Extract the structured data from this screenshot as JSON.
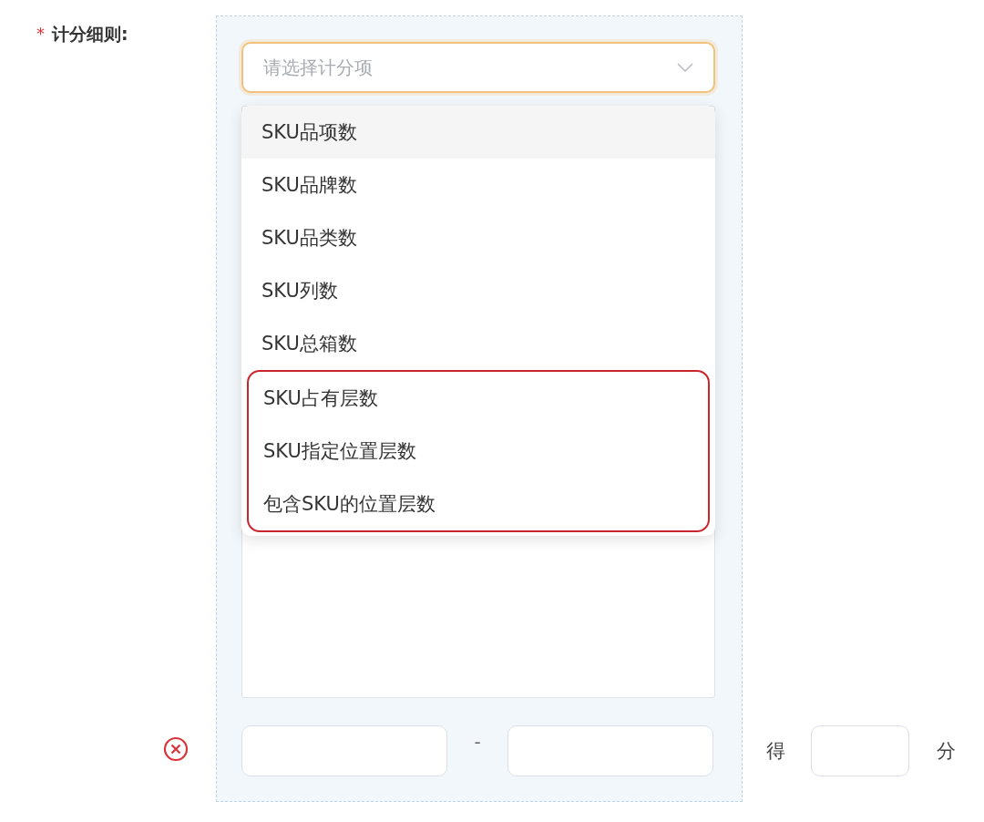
{
  "field": {
    "label": "计分细则:",
    "required_mark": "*"
  },
  "select": {
    "placeholder": "请选择计分项",
    "open": true
  },
  "options": [
    {
      "label": "SKU品项数",
      "hovered": true,
      "highlighted": false
    },
    {
      "label": "SKU品牌数",
      "hovered": false,
      "highlighted": false
    },
    {
      "label": "SKU品类数",
      "hovered": false,
      "highlighted": false
    },
    {
      "label": "SKU列数",
      "hovered": false,
      "highlighted": false
    },
    {
      "label": "SKU总箱数",
      "hovered": false,
      "highlighted": false
    },
    {
      "label": "SKU占有层数",
      "hovered": false,
      "highlighted": true
    },
    {
      "label": "SKU指定位置层数",
      "hovered": false,
      "highlighted": true
    },
    {
      "label": "包含SKU的位置层数",
      "hovered": false,
      "highlighted": true
    }
  ],
  "range": {
    "separator": "-",
    "score_prefix": "得",
    "score_suffix": "分"
  }
}
